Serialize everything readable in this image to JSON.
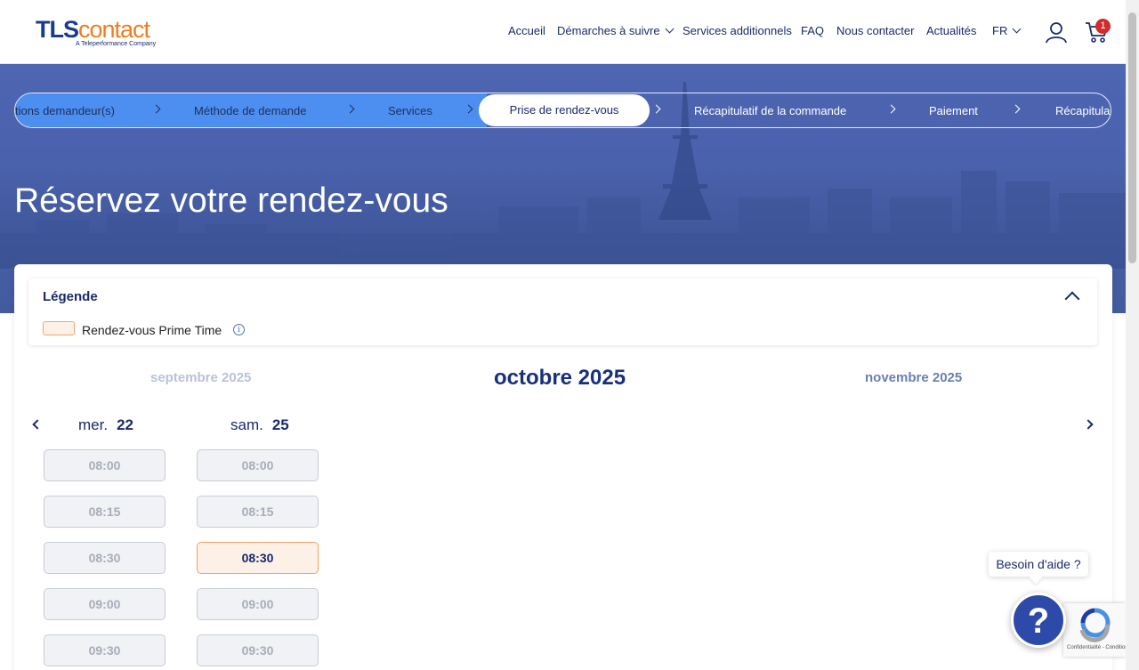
{
  "header": {
    "logo_main_a": "TLS",
    "logo_main_b": "contact",
    "logo_sub": "A Teleperformance Company",
    "nav": [
      "Accueil",
      "Démarches à suivre",
      "Services additionnels",
      "FAQ",
      "Nous contacter",
      "Actualités"
    ],
    "lang": "FR",
    "cart_count": "1",
    "user_icon": "user-icon",
    "cart_icon": "cart-icon"
  },
  "stepper": {
    "steps": [
      "tions demandeur(s)",
      "Méthode de demande",
      "Services",
      "Prise de rendez-vous",
      "Récapitulatif de la commande",
      "Paiement",
      "Récapitula"
    ],
    "active_index": 3
  },
  "page": {
    "title": "Réservez votre rendez-vous"
  },
  "legend": {
    "title": "Légende",
    "prime_label": "Rendez-vous Prime Time",
    "info_glyph": "i"
  },
  "calendar": {
    "months": [
      "septembre 2025",
      "octobre 2025",
      "novembre 2025"
    ],
    "days": [
      {
        "weekday": "mer.",
        "date": "22",
        "slots": [
          "08:00",
          "08:15",
          "08:30",
          "09:00",
          "09:30"
        ],
        "prime_slot": null
      },
      {
        "weekday": "sam.",
        "date": "25",
        "slots": [
          "08:00",
          "08:15",
          "08:30",
          "09:00",
          "09:30"
        ],
        "prime_slot": "08:30"
      }
    ]
  },
  "help": {
    "tooltip": "Besoin d'aide ?",
    "glyph": "?",
    "recaptcha_text": "Confidentialité - Conditions"
  },
  "colors": {
    "brand_blue": "#1a3a8f",
    "brand_orange": "#f07d1d",
    "prime_border": "#f0a263",
    "prime_bg": "#fdf1e7"
  }
}
